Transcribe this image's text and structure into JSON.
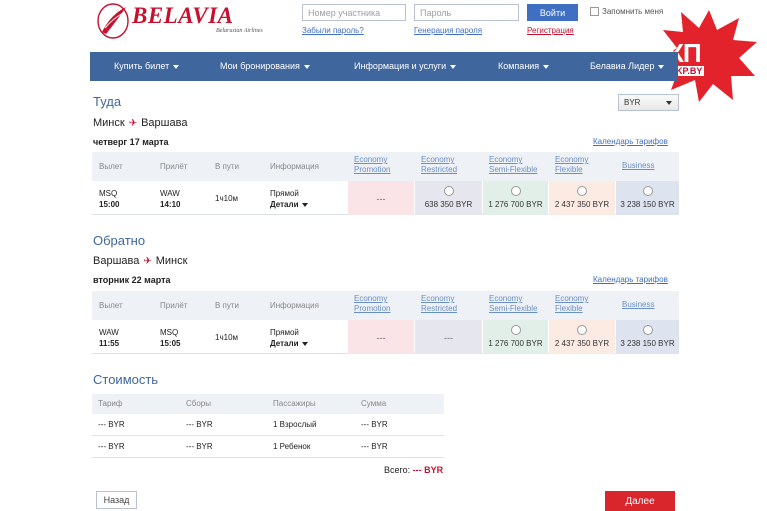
{
  "header": {
    "brand": "BELAVIA",
    "brand_sub": "Belarusian Airlines",
    "member_placeholder": "Номер участника",
    "password_placeholder": "Пароль",
    "login_label": "Войти",
    "remember_label": "Запомнить меня",
    "forgot_link": "Забыли пароль?",
    "generate_link": "Генерация пароля",
    "register_link": "Регистрация"
  },
  "watermark": {
    "text": "КП",
    "sub": "KP.BY"
  },
  "nav": {
    "items": [
      "Купить билет",
      "Мои бронирования",
      "Информация и услуги",
      "Компания",
      "Белавиа Лидер"
    ]
  },
  "currency": {
    "selected": "BYR"
  },
  "outbound": {
    "title": "Туда",
    "from": "Минск",
    "to": "Варшава",
    "date": "четверг 17 марта",
    "calendar_link": "Календарь тарифов",
    "headers": {
      "depart": "Вылет",
      "arrive": "Прилёт",
      "duration": "В пути",
      "info": "Информация"
    },
    "fares": [
      {
        "name": "Economy Promotion",
        "price": "---",
        "color": "#fbe4e8",
        "selectable": false
      },
      {
        "name": "Economy Restricted",
        "price": "638 350 BYR",
        "color": "#e6e6ee",
        "selectable": true
      },
      {
        "name": "Economy Semi-Flexible",
        "price": "1 276 700 BYR",
        "color": "#e2efe8",
        "selectable": true
      },
      {
        "name": "Economy Flexible",
        "price": "2 437 350 BYR",
        "color": "#fcebe3",
        "selectable": true
      },
      {
        "name": "Business",
        "price": "3 238 150 BYR",
        "color": "#dde4f0",
        "selectable": true
      }
    ],
    "flight": {
      "dep_code": "MSQ",
      "dep_time": "15:00",
      "arr_code": "WAW",
      "arr_time": "14:10",
      "duration": "1ч10м",
      "type": "Прямой",
      "details": "Детали"
    }
  },
  "inbound": {
    "title": "Обратно",
    "from": "Варшава",
    "to": "Минск",
    "date": "вторник 22 марта",
    "calendar_link": "Календарь тарифов",
    "headers": {
      "depart": "Вылет",
      "arrive": "Прилёт",
      "duration": "В пути",
      "info": "Информация"
    },
    "fares": [
      {
        "name": "Economy Promotion",
        "price": "---",
        "color": "#fbe4e8",
        "selectable": false
      },
      {
        "name": "Economy Restricted",
        "price": "---",
        "color": "#e6e6ee",
        "selectable": false
      },
      {
        "name": "Economy Semi-Flexible",
        "price": "1 276 700 BYR",
        "color": "#e2efe8",
        "selectable": true
      },
      {
        "name": "Economy Flexible",
        "price": "2 437 350 BYR",
        "color": "#fcebe3",
        "selectable": true
      },
      {
        "name": "Business",
        "price": "3 238 150 BYR",
        "color": "#dde4f0",
        "selectable": true
      }
    ],
    "flight": {
      "dep_code": "WAW",
      "dep_time": "11:55",
      "arr_code": "MSQ",
      "arr_time": "15:05",
      "duration": "1ч10м",
      "type": "Прямой",
      "details": "Детали"
    }
  },
  "cost": {
    "title": "Стоимость",
    "headers": [
      "Тариф",
      "Сборы",
      "Пассажиры",
      "Сумма"
    ],
    "rows": [
      [
        "--- BYR",
        "--- BYR",
        "1 Взрослый",
        "--- BYR"
      ],
      [
        "--- BYR",
        "--- BYR",
        "1 Ребенок",
        "--- BYR"
      ]
    ],
    "total_label": "Всего:",
    "total_value": "--- BYR"
  },
  "actions": {
    "back_label": "Назад",
    "next_label": "Далее"
  },
  "colors": {
    "brand_red": "#c8102e",
    "nav_blue": "#40669e",
    "link_blue": "#3f6fc1",
    "next_red": "#d9262c"
  }
}
